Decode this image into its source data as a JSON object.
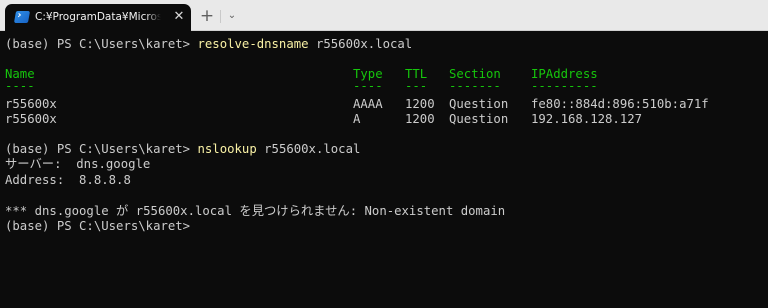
{
  "titlebar": {
    "tab_title": "C:¥ProgramData¥Microsoft¥Windows¥Start Menu",
    "close_glyph": "✕",
    "new_tab_glyph": "+",
    "dropdown_glyph": "⌄",
    "tab_icon": "powershell-icon"
  },
  "terminal": {
    "prompt1": "(base) PS C:\\Users\\karet> ",
    "command1": "resolve-dnsname",
    "arg1": " r55600x.local",
    "table": {
      "headers": [
        "Name",
        "Type",
        "TTL",
        "Section",
        "IPAddress"
      ],
      "underlines": [
        "----",
        "----",
        "---",
        "-------",
        "---------"
      ],
      "rows": [
        [
          "r55600x",
          "AAAA",
          "1200",
          "Question",
          "fe80::884d:896:510b:a71f"
        ],
        [
          "r55600x",
          "A",
          "1200",
          "Question",
          "192.168.128.127"
        ]
      ]
    },
    "prompt2": "(base) PS C:\\Users\\karet> ",
    "command2": "nslookup",
    "arg2": " r55600x.local",
    "server_line": "サーバー:  dns.google",
    "address_line": "Address:  8.8.8.8",
    "error_line": "*** dns.google が r55600x.local を見つけられません: Non-existent domain",
    "prompt3": "(base) PS C:\\Users\\karet>"
  },
  "colors": {
    "background": "#0c0c0c",
    "text": "#cccccc",
    "command": "#f9f1a5",
    "table_header": "#16c60c",
    "titlebar": "#e9e9e9"
  }
}
